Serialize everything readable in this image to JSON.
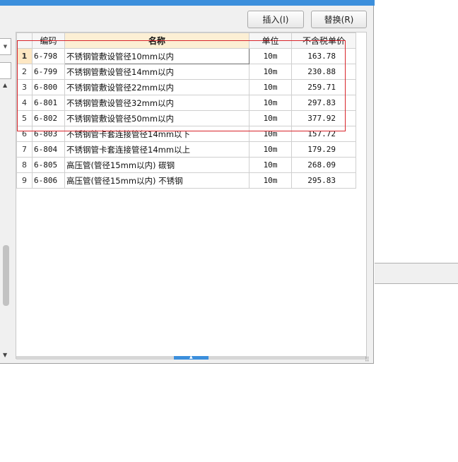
{
  "toolbar": {
    "insert_label": "插入(I)",
    "replace_label": "替换(R)"
  },
  "table": {
    "columns": [
      "编码",
      "名称",
      "单位",
      "不含税单价"
    ],
    "rows": [
      {
        "num": "1",
        "code": "6-798",
        "name": "不锈钢管敷设管径10mm以内",
        "unit": "10m",
        "price": "163.78"
      },
      {
        "num": "2",
        "code": "6-799",
        "name": "不锈钢管敷设管径14mm以内",
        "unit": "10m",
        "price": "230.88"
      },
      {
        "num": "3",
        "code": "6-800",
        "name": "不锈钢管敷设管径22mm以内",
        "unit": "10m",
        "price": "259.71"
      },
      {
        "num": "4",
        "code": "6-801",
        "name": "不锈钢管敷设管径32mm以内",
        "unit": "10m",
        "price": "297.83"
      },
      {
        "num": "5",
        "code": "6-802",
        "name": "不锈钢管敷设管径50mm以内",
        "unit": "10m",
        "price": "377.92"
      },
      {
        "num": "6",
        "code": "6-803",
        "name": "不锈钢管卡套连接管径14mm以下",
        "unit": "10m",
        "price": "157.72"
      },
      {
        "num": "7",
        "code": "6-804",
        "name": "不锈钢管卡套连接管径14mm以上",
        "unit": "10m",
        "price": "179.29"
      },
      {
        "num": "8",
        "code": "6-805",
        "name": "高压管(管径15mm以内) 碳钢",
        "unit": "10m",
        "price": "268.09"
      },
      {
        "num": "9",
        "code": "6-806",
        "name": "高压管(管径15mm以内) 不锈钢",
        "unit": "10m",
        "price": "295.83"
      }
    ]
  },
  "colors": {
    "title_bar": "#3c8fdc",
    "selection_highlight": "#fde7c3",
    "annotation_box": "#d9252b"
  }
}
